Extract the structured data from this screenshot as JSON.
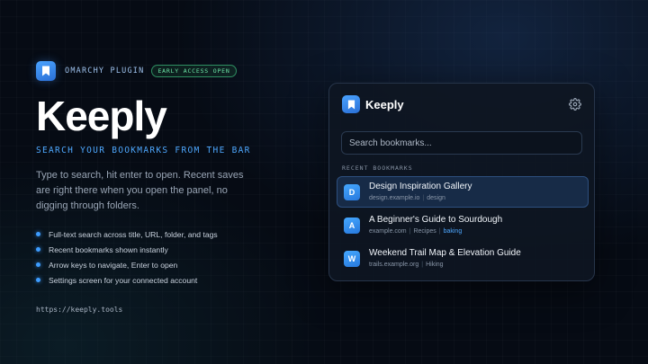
{
  "hero": {
    "plugin_label": "OMARCHY PLUGIN",
    "badge": "EARLY ACCESS OPEN",
    "title": "Keeply",
    "tagline": "SEARCH YOUR BOOKMARKS FROM THE BAR",
    "description": "Type to search, hit enter to open. Recent saves are right there when you open the panel, no digging through folders.",
    "features": [
      "Full-text search across title, URL, folder, and tags",
      "Recent bookmarks shown instantly",
      "Arrow keys to navigate, Enter to open",
      "Settings screen for your connected account"
    ],
    "url": "https://keeply.tools",
    "logo_icon": "bookmark-icon"
  },
  "panel": {
    "title": "Keeply",
    "settings_icon": "gear-icon",
    "search": {
      "placeholder": "Search bookmarks...",
      "value": ""
    },
    "section_label": "RECENT BOOKMARKS",
    "bookmarks": [
      {
        "initial": "D",
        "title": "Design Inspiration Gallery",
        "domain": "design.example.io",
        "folder": "",
        "tag": "design",
        "selected": true
      },
      {
        "initial": "A",
        "title": "A Beginner's Guide to Sourdough",
        "domain": "example.com",
        "folder": "Recipes",
        "tag": "baking",
        "selected": false
      },
      {
        "initial": "W",
        "title": "Weekend Trail Map & Elevation Guide",
        "domain": "trails.example.org",
        "folder": "",
        "tag": "Hiking",
        "selected": false
      }
    ]
  },
  "colors": {
    "accent": "#4ea8ff",
    "badge_green": "#6ee7a8",
    "background": "#060b14",
    "panel": "#0e1622",
    "selected_row": "#172b47"
  }
}
